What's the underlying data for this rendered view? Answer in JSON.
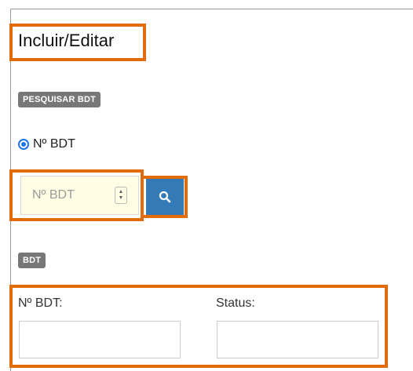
{
  "header": {
    "title": "Incluir/Editar"
  },
  "search_section": {
    "badge": "PESQUISAR BDT",
    "radio_label": "Nº BDT",
    "input_placeholder": "Nº BDT",
    "input_value": ""
  },
  "bdt_section": {
    "badge": "BDT",
    "fields": [
      {
        "label": "Nº BDT:",
        "value": ""
      },
      {
        "label": "Status:",
        "value": ""
      }
    ]
  },
  "colors": {
    "highlight": "#e36c0a",
    "badge_bg": "#777777",
    "primary_button": "#337ab7",
    "input_bg": "#fffde3",
    "radio": "#1a73e8"
  },
  "icons": {
    "search": "magnifying-glass",
    "spinner": "up-down-arrows"
  }
}
